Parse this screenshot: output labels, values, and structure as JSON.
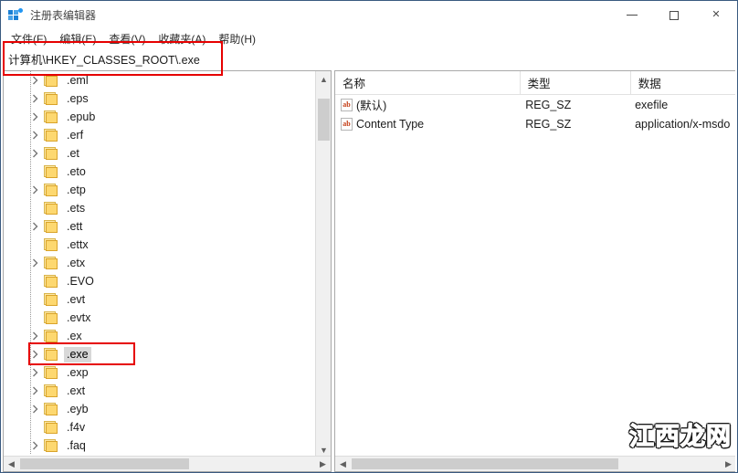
{
  "window": {
    "title": "注册表编辑器",
    "app_icon": "registry-editor-icon",
    "caption": {
      "minimize": "minimize-icon",
      "maximize": "maximize-icon",
      "close": "✕"
    }
  },
  "menubar": {
    "items": [
      {
        "label": "文件(F)"
      },
      {
        "label": "编辑(E)"
      },
      {
        "label": "查看(V)"
      },
      {
        "label": "收藏夹(A)"
      },
      {
        "label": "帮助(H)"
      }
    ]
  },
  "address": {
    "value": "计算机\\HKEY_CLASSES_ROOT\\.exe"
  },
  "tree": {
    "items": [
      {
        "label": ".eml",
        "expandable": true,
        "selected": false
      },
      {
        "label": ".eps",
        "expandable": true,
        "selected": false
      },
      {
        "label": ".epub",
        "expandable": true,
        "selected": false
      },
      {
        "label": ".erf",
        "expandable": true,
        "selected": false
      },
      {
        "label": ".et",
        "expandable": true,
        "selected": false
      },
      {
        "label": ".eto",
        "expandable": false,
        "selected": false
      },
      {
        "label": ".etp",
        "expandable": true,
        "selected": false
      },
      {
        "label": ".ets",
        "expandable": false,
        "selected": false
      },
      {
        "label": ".ett",
        "expandable": true,
        "selected": false
      },
      {
        "label": ".ettx",
        "expandable": false,
        "selected": false
      },
      {
        "label": ".etx",
        "expandable": true,
        "selected": false
      },
      {
        "label": ".EVO",
        "expandable": false,
        "selected": false
      },
      {
        "label": ".evt",
        "expandable": false,
        "selected": false
      },
      {
        "label": ".evtx",
        "expandable": false,
        "selected": false
      },
      {
        "label": ".ex",
        "expandable": true,
        "selected": false
      },
      {
        "label": ".exe",
        "expandable": true,
        "selected": true
      },
      {
        "label": ".exp",
        "expandable": true,
        "selected": false
      },
      {
        "label": ".ext",
        "expandable": true,
        "selected": false
      },
      {
        "label": ".eyb",
        "expandable": true,
        "selected": false
      },
      {
        "label": ".f4v",
        "expandable": false,
        "selected": false
      },
      {
        "label": ".faq",
        "expandable": true,
        "selected": false
      }
    ]
  },
  "values_list": {
    "columns": [
      "名称",
      "类型",
      "数据"
    ],
    "rows": [
      {
        "icon": "string-value-icon",
        "name": "(默认)",
        "type": "REG_SZ",
        "data": "exefile"
      },
      {
        "icon": "string-value-icon",
        "name": "Content Type",
        "type": "REG_SZ",
        "data": "application/x-msdo"
      }
    ]
  },
  "scrollbars": {
    "left_vertical": {
      "up": "▲",
      "down": "▼"
    },
    "left_horizontal": {
      "left": "◀",
      "right": "▶"
    },
    "right_horizontal": {
      "left": "◀",
      "right": "▶"
    }
  },
  "watermark": {
    "text": "江西龙网"
  },
  "colors": {
    "annotation": "#e60000",
    "selection": "#d8d8d8",
    "folder": "#fdd870",
    "watermark": "#f08a1e"
  }
}
